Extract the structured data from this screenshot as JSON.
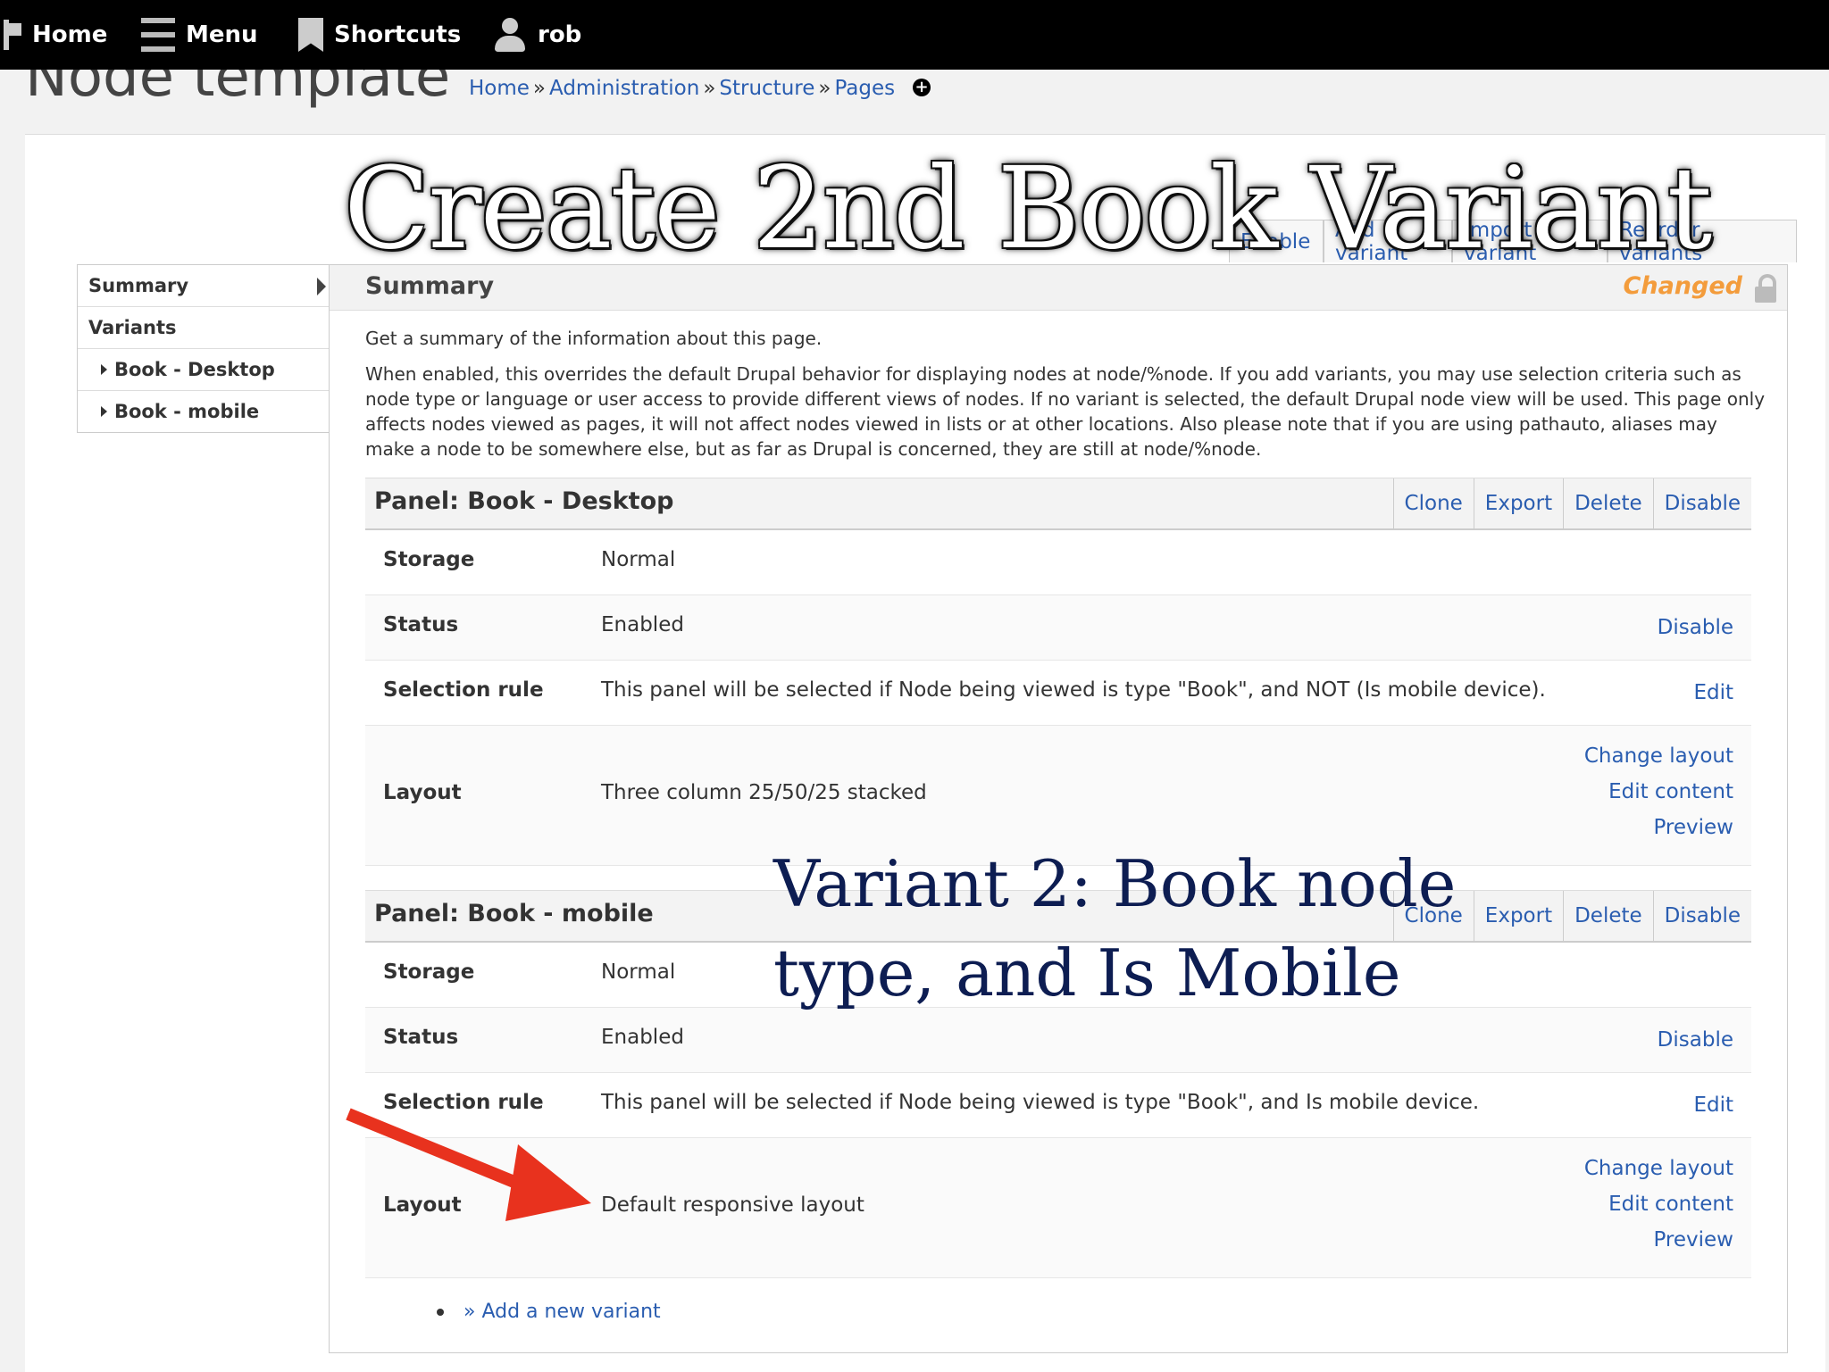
{
  "toolbar": {
    "home": "Home",
    "menu": "Menu",
    "shortcuts": "Shortcuts",
    "user": "rob"
  },
  "page": {
    "title": "Node template",
    "breadcrumb": [
      "Home",
      "Administration",
      "Structure",
      "Pages"
    ],
    "breadcrumb_sep": "»"
  },
  "overlay": {
    "slide_title": "Create 2nd Book Variant",
    "annotation_line1": "Variant 2: Book node",
    "annotation_line2": "type, and Is Mobile",
    "arrow_color": "#e8321e"
  },
  "top_tabs": [
    "Enable",
    "Add variant",
    "Import variant",
    "Reorder variants"
  ],
  "sidebar": {
    "summary": "Summary",
    "variants": "Variants",
    "items": [
      "Book - Desktop",
      "Book - mobile"
    ]
  },
  "main": {
    "title": "Summary",
    "changed": "Changed",
    "desc1": "Get a summary of the information about this page.",
    "desc2": "When enabled, this overrides the default Drupal behavior for displaying nodes at node/%node. If you add variants, you may use selection criteria such as node type or language or user access to provide different views of nodes. If no variant is selected, the default Drupal node view will be used. This page only affects nodes viewed as pages, it will not affect nodes viewed in lists or at other locations. Also please note that if you are using pathauto, aliases may make a node to be somewhere else, but as far as Drupal is concerned, they are still at node/%node."
  },
  "panel_actions": [
    "Clone",
    "Export",
    "Delete",
    "Disable"
  ],
  "labels": {
    "storage": "Storage",
    "status": "Status",
    "selection_rule": "Selection rule",
    "layout": "Layout"
  },
  "panels": [
    {
      "title": "Panel: Book - Desktop",
      "storage": "Normal",
      "status": "Enabled",
      "status_link": "Disable",
      "selection_rule": "This panel will be selected if Node being viewed is type \"Book\", and NOT (Is mobile device).",
      "selection_link": "Edit",
      "layout": "Three column 25/50/25 stacked",
      "layout_links": [
        "Change layout",
        "Edit content",
        "Preview"
      ]
    },
    {
      "title": "Panel: Book - mobile",
      "storage": "Normal",
      "status": "Enabled",
      "status_link": "Disable",
      "selection_rule": "This panel will be selected if Node being viewed is type \"Book\", and Is mobile device.",
      "selection_link": "Edit",
      "layout": "Default responsive layout",
      "layout_links": [
        "Change layout",
        "Edit content",
        "Preview"
      ]
    }
  ],
  "add_variant": "» Add a new variant",
  "colors": {
    "link": "#2a5db0",
    "changed": "#f39c3c",
    "annotation": "#0d1d52"
  }
}
